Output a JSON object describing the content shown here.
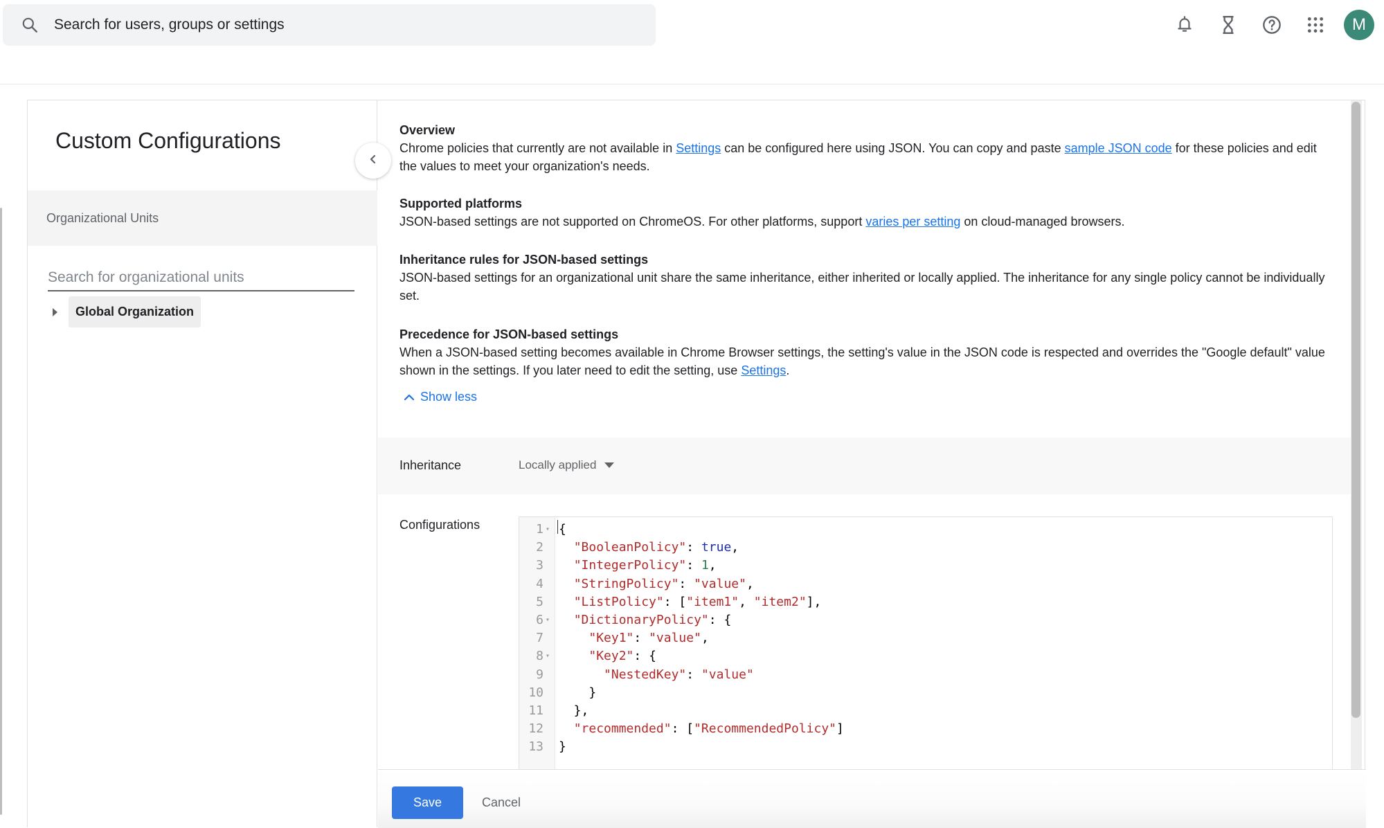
{
  "topbar": {
    "search_placeholder": "Search for users, groups or settings",
    "icons": [
      "search-icon",
      "notifications-icon",
      "hourglass-icon",
      "help-icon",
      "apps-grid-icon"
    ],
    "avatar_letter": "M",
    "avatar_color": "#3b8a78"
  },
  "left_panel": {
    "title": "Custom Configurations",
    "ou_header": "Organizational Units",
    "ou_search_placeholder": "Search for organizational units",
    "tree": [
      {
        "label": "Global Organization",
        "expanded": false
      }
    ]
  },
  "info": {
    "overview": {
      "heading": "Overview",
      "text_1": "Chrome policies that currently are not available in ",
      "link_1": "Settings",
      "text_2": " can be configured here using JSON. You can copy and paste ",
      "link_2": "sample JSON code",
      "text_3": " for these policies and edit the values to meet your organization's needs."
    },
    "platforms": {
      "heading": "Supported platforms",
      "text_1": "JSON-based settings are not supported on ChromeOS. For other platforms, support ",
      "link_1": "varies per setting",
      "text_2": " on cloud-managed browsers."
    },
    "inheritance_rules": {
      "heading": "Inheritance rules for JSON-based settings",
      "text": "JSON-based settings for an organizational unit share the same inheritance, either inherited or locally applied. The inheritance for any single policy cannot be individually set."
    },
    "precedence": {
      "heading": "Precedence for JSON-based settings",
      "text_1": "When a JSON-based setting becomes available in Chrome Browser settings, the setting's value in the JSON code is respected and overrides the \"Google default\" value shown in the settings. If you later need to edit the setting, use ",
      "link_1": "Settings",
      "text_2": "."
    },
    "show_less": "Show less"
  },
  "inheritance": {
    "label": "Inheritance",
    "selected": "Locally applied"
  },
  "configurations": {
    "label": "Configurations",
    "lines": [
      {
        "n": "1",
        "fold": true,
        "tokens": [
          [
            "p",
            "{"
          ]
        ]
      },
      {
        "n": "2",
        "fold": false,
        "tokens": [
          [
            "p",
            "  "
          ],
          [
            "s",
            "\"BooleanPolicy\""
          ],
          [
            "p",
            ": "
          ],
          [
            "k",
            "true"
          ],
          [
            "p",
            ","
          ]
        ]
      },
      {
        "n": "3",
        "fold": false,
        "tokens": [
          [
            "p",
            "  "
          ],
          [
            "s",
            "\"IntegerPolicy\""
          ],
          [
            "p",
            ": "
          ],
          [
            "n",
            "1"
          ],
          [
            "p",
            ","
          ]
        ]
      },
      {
        "n": "4",
        "fold": false,
        "tokens": [
          [
            "p",
            "  "
          ],
          [
            "s",
            "\"StringPolicy\""
          ],
          [
            "p",
            ": "
          ],
          [
            "s",
            "\"value\""
          ],
          [
            "p",
            ","
          ]
        ]
      },
      {
        "n": "5",
        "fold": false,
        "tokens": [
          [
            "p",
            "  "
          ],
          [
            "s",
            "\"ListPolicy\""
          ],
          [
            "p",
            ": ["
          ],
          [
            "s",
            "\"item1\""
          ],
          [
            "p",
            ", "
          ],
          [
            "s",
            "\"item2\""
          ],
          [
            "p",
            "],"
          ]
        ]
      },
      {
        "n": "6",
        "fold": true,
        "tokens": [
          [
            "p",
            "  "
          ],
          [
            "s",
            "\"DictionaryPolicy\""
          ],
          [
            "p",
            ": {"
          ]
        ]
      },
      {
        "n": "7",
        "fold": false,
        "tokens": [
          [
            "p",
            "    "
          ],
          [
            "s",
            "\"Key1\""
          ],
          [
            "p",
            ": "
          ],
          [
            "s",
            "\"value\""
          ],
          [
            "p",
            ","
          ]
        ]
      },
      {
        "n": "8",
        "fold": true,
        "tokens": [
          [
            "p",
            "    "
          ],
          [
            "s",
            "\"Key2\""
          ],
          [
            "p",
            ": {"
          ]
        ]
      },
      {
        "n": "9",
        "fold": false,
        "tokens": [
          [
            "p",
            "      "
          ],
          [
            "s",
            "\"NestedKey\""
          ],
          [
            "p",
            ": "
          ],
          [
            "s",
            "\"value\""
          ]
        ]
      },
      {
        "n": "10",
        "fold": false,
        "tokens": [
          [
            "p",
            "    }"
          ]
        ]
      },
      {
        "n": "11",
        "fold": false,
        "tokens": [
          [
            "p",
            "  },"
          ]
        ]
      },
      {
        "n": "12",
        "fold": false,
        "tokens": [
          [
            "p",
            "  "
          ],
          [
            "s",
            "\"recommended\""
          ],
          [
            "p",
            ": ["
          ],
          [
            "s",
            "\"RecommendedPolicy\""
          ],
          [
            "p",
            "]"
          ]
        ]
      },
      {
        "n": "13",
        "fold": false,
        "tokens": [
          [
            "p",
            "}"
          ]
        ]
      }
    ]
  },
  "actions": {
    "save": "Save",
    "cancel": "Cancel",
    "save_color": "#3478e0"
  },
  "colors": {
    "link": "#1a73e8",
    "json_string": "#b22b2b",
    "json_keyword": "#1c2eab",
    "json_number": "#2e7d4f"
  }
}
